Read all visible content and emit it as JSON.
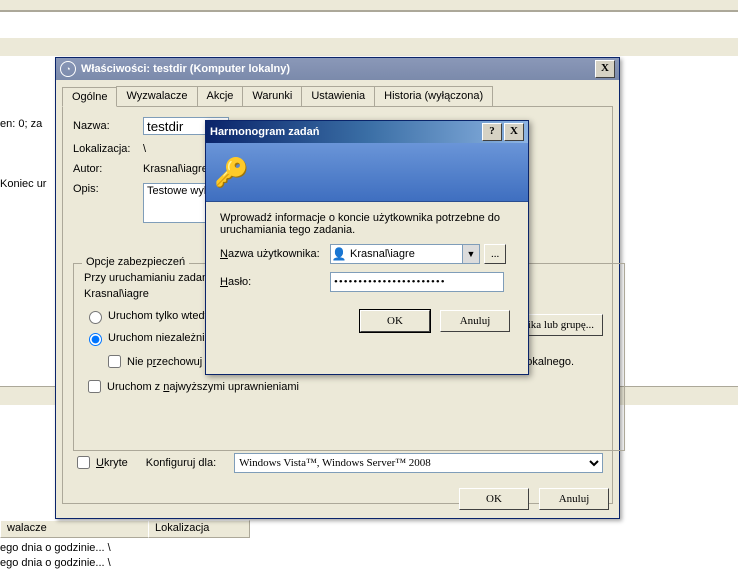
{
  "background": {
    "left1": "en: 0; za",
    "left2": "Koniec ur",
    "colhdr1": "walacze",
    "colhdr2": "Lokalizacja",
    "row1": "ego dnia o godzinie...   \\",
    "row2": "ego dnia o godzinie...   \\"
  },
  "propWin": {
    "title": "Właściwości: testdir (Komputer lokalny)",
    "close": "X",
    "tabs": [
      "Ogólne",
      "Wyzwalacze",
      "Akcje",
      "Warunki",
      "Ustawienia",
      "Historia (wyłączona)"
    ],
    "labels": {
      "name": "Nazwa:",
      "location": "Lokalizacja:",
      "author": "Autor:",
      "description": "Opis:"
    },
    "values": {
      "name": "testdir",
      "location": "\\",
      "author": "Krasnal\\iagre",
      "description": "Testowe wyli"
    },
    "security": {
      "legend": "Opcje zabezpieczeń",
      "runAsIntro": "Przy uruchamianiu zadani",
      "account": "Krasnal\\iagre",
      "changeBtn": "ownika lub grupę...",
      "radio1": "Uruchom tylko wtedy,",
      "radio2": "Uruchom niezależnie od tego, czy użytkownik jest zalogowany",
      "chkNoPwd_pre": "Nie p",
      "chkNoPwd_u": "r",
      "chkNoPwd_post": "zechowuj hasła. Zadanie będzie miało dostęp tylko do zasobów komputera lokalnego.",
      "chkHighest_pre": "Uruchom z ",
      "chkHighest_u": "n",
      "chkHighest_post": "ajwyższymi uprawnieniami"
    },
    "bottom": {
      "hidden_u": "U",
      "hidden_post": "kryte",
      "configFor_pre": "Konfiguru",
      "configFor_u": "j",
      "configFor_post": " dla:",
      "configValue": "Windows Vista™, Windows Server™ 2008"
    },
    "footer": {
      "ok": "OK",
      "cancel": "Anuluj"
    }
  },
  "modal": {
    "title": "Harmonogram zadań",
    "help": "?",
    "close": "X",
    "instruction": "Wprowadź informacje o koncie użytkownika potrzebne do uruchamiania tego zadania.",
    "userLabel_u": "N",
    "userLabel_post": "azwa użytkownika:",
    "userValue": "Krasnal\\iagre",
    "browse": "...",
    "pwdLabel_u": "H",
    "pwdLabel_post": "asło:",
    "pwdMask": "•••••••••••••••••••••••",
    "ok": "OK",
    "cancel": "Anuluj",
    "keysIcon": "🔑"
  }
}
